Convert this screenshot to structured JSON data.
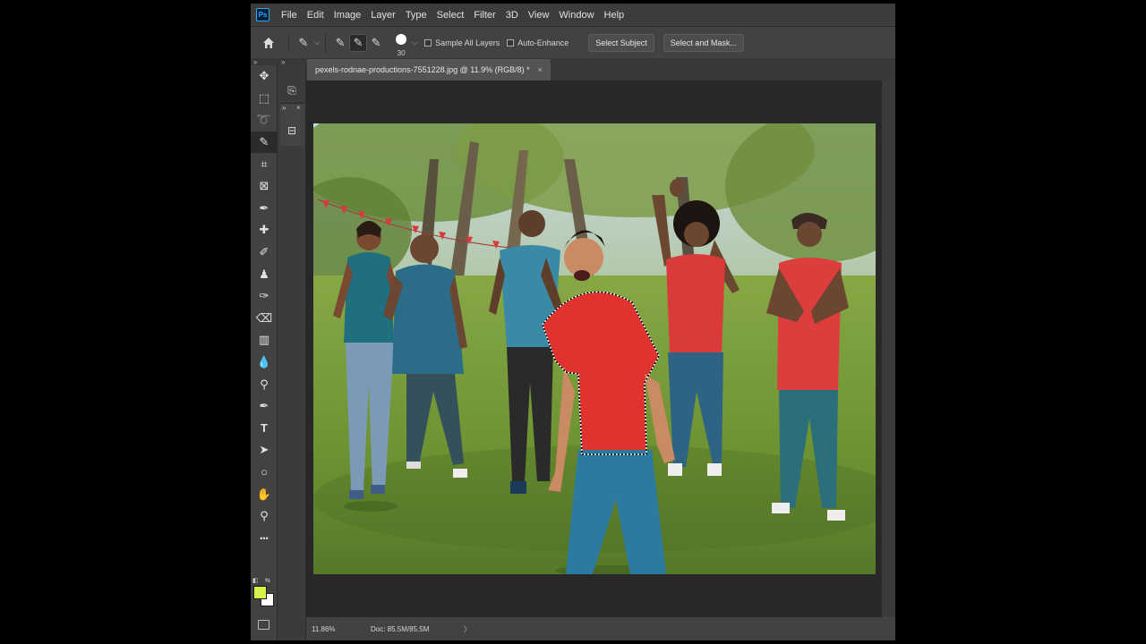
{
  "menu": [
    "File",
    "Edit",
    "Image",
    "Layer",
    "Type",
    "Select",
    "Filter",
    "3D",
    "View",
    "Window",
    "Help"
  ],
  "app_logo_text": "Ps",
  "options": {
    "brush_size": "30",
    "sample_all_layers": "Sample All Layers",
    "auto_enhance": "Auto-Enhance",
    "select_subject": "Select Subject",
    "select_and_mask": "Select and Mask..."
  },
  "document": {
    "tab_title": "pexels-rodnae-productions-7551228.jpg @ 11.9% (RGB/8) *",
    "close_glyph": "×"
  },
  "status": {
    "zoom": "11.86%",
    "doc": "Doc: 85.5M/85.5M",
    "arrow": "〉"
  },
  "colors": {
    "foreground": "#d9f04a",
    "background": "#ffffff",
    "accent": "#31a8ff"
  },
  "tools": [
    {
      "name": "move-tool-icon",
      "glyph": "✥"
    },
    {
      "name": "rectangular-marquee-icon",
      "glyph": "⬚"
    },
    {
      "name": "lasso-tool-icon",
      "glyph": "➰"
    },
    {
      "name": "quick-selection-icon",
      "glyph": "✎"
    },
    {
      "name": "crop-tool-icon",
      "glyph": "⌗"
    },
    {
      "name": "frame-tool-icon",
      "glyph": "⊠"
    },
    {
      "name": "eyedropper-icon",
      "glyph": "✒"
    },
    {
      "name": "healing-brush-icon",
      "glyph": "✚"
    },
    {
      "name": "brush-tool-icon",
      "glyph": "✐"
    },
    {
      "name": "clone-stamp-icon",
      "glyph": "♟"
    },
    {
      "name": "history-brush-icon",
      "glyph": "✑"
    },
    {
      "name": "eraser-icon",
      "glyph": "⌫"
    },
    {
      "name": "gradient-tool-icon",
      "glyph": "▥"
    },
    {
      "name": "blur-tool-icon",
      "glyph": "💧"
    },
    {
      "name": "dodge-tool-icon",
      "glyph": "⚲"
    },
    {
      "name": "pen-tool-icon",
      "glyph": "✒"
    },
    {
      "name": "type-tool-icon",
      "glyph": "T"
    },
    {
      "name": "path-selection-icon",
      "glyph": "➤"
    },
    {
      "name": "ellipse-tool-icon",
      "glyph": "○"
    },
    {
      "name": "hand-tool-icon",
      "glyph": "✋"
    },
    {
      "name": "zoom-tool-icon",
      "glyph": "⚲"
    },
    {
      "name": "more-tools-icon",
      "glyph": "•••"
    }
  ]
}
